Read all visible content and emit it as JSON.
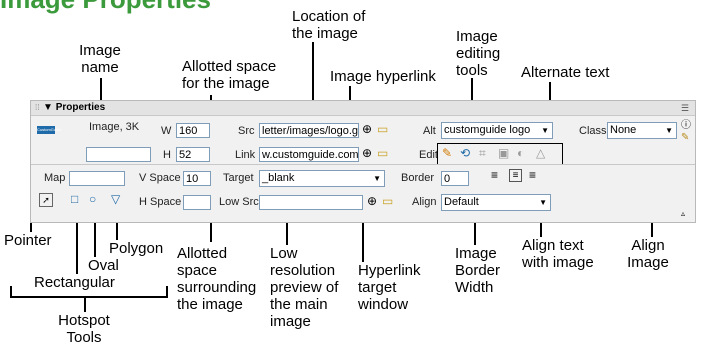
{
  "title": "Image Properties",
  "callouts": {
    "location": [
      "Location of",
      "the image"
    ],
    "image_name": [
      "Image",
      "name"
    ],
    "allotted": [
      "Allotted space",
      "for the image"
    ],
    "hyperlink": "Image hyperlink",
    "editing": [
      "Image",
      "editing",
      "tools"
    ],
    "alt_text": "Alternate text",
    "pointer": "Pointer",
    "polygon": "Polygon",
    "oval": "Oval",
    "rectangular": "Rectangular",
    "hotspot": [
      "Hotspot",
      "Tools"
    ],
    "surrounding": [
      "Allotted",
      "space",
      "surrounding",
      "the image"
    ],
    "lowres": [
      "Low",
      "resolution",
      "preview of",
      "the main",
      "image"
    ],
    "target": [
      "Hyperlink",
      "target",
      "window"
    ],
    "border": [
      "Image",
      "Border",
      "Width"
    ],
    "align_text": [
      "Align text",
      "with image"
    ],
    "align_image": [
      "Align",
      "Image"
    ]
  },
  "panel": {
    "title": "Properties",
    "image_info": "Image, 3K",
    "w_label": "W",
    "w_value": "160",
    "h_label": "H",
    "h_value": "52",
    "src_label": "Src",
    "src_value": "letter/images/logo.gif",
    "link_label": "Link",
    "link_value": "w.customguide.com",
    "alt_label": "Alt",
    "alt_value": "customguide logo",
    "class_label": "Class",
    "class_value": "None",
    "edit_label": "Edit",
    "map_label": "Map",
    "vspace_label": "V Space",
    "vspace_value": "10",
    "hspace_label": "H Space",
    "target_label": "Target",
    "target_value": "_blank",
    "lowsrc_label": "Low Src",
    "border_label": "Border",
    "border_value": "0",
    "align_label": "Align",
    "align_value": "Default"
  }
}
